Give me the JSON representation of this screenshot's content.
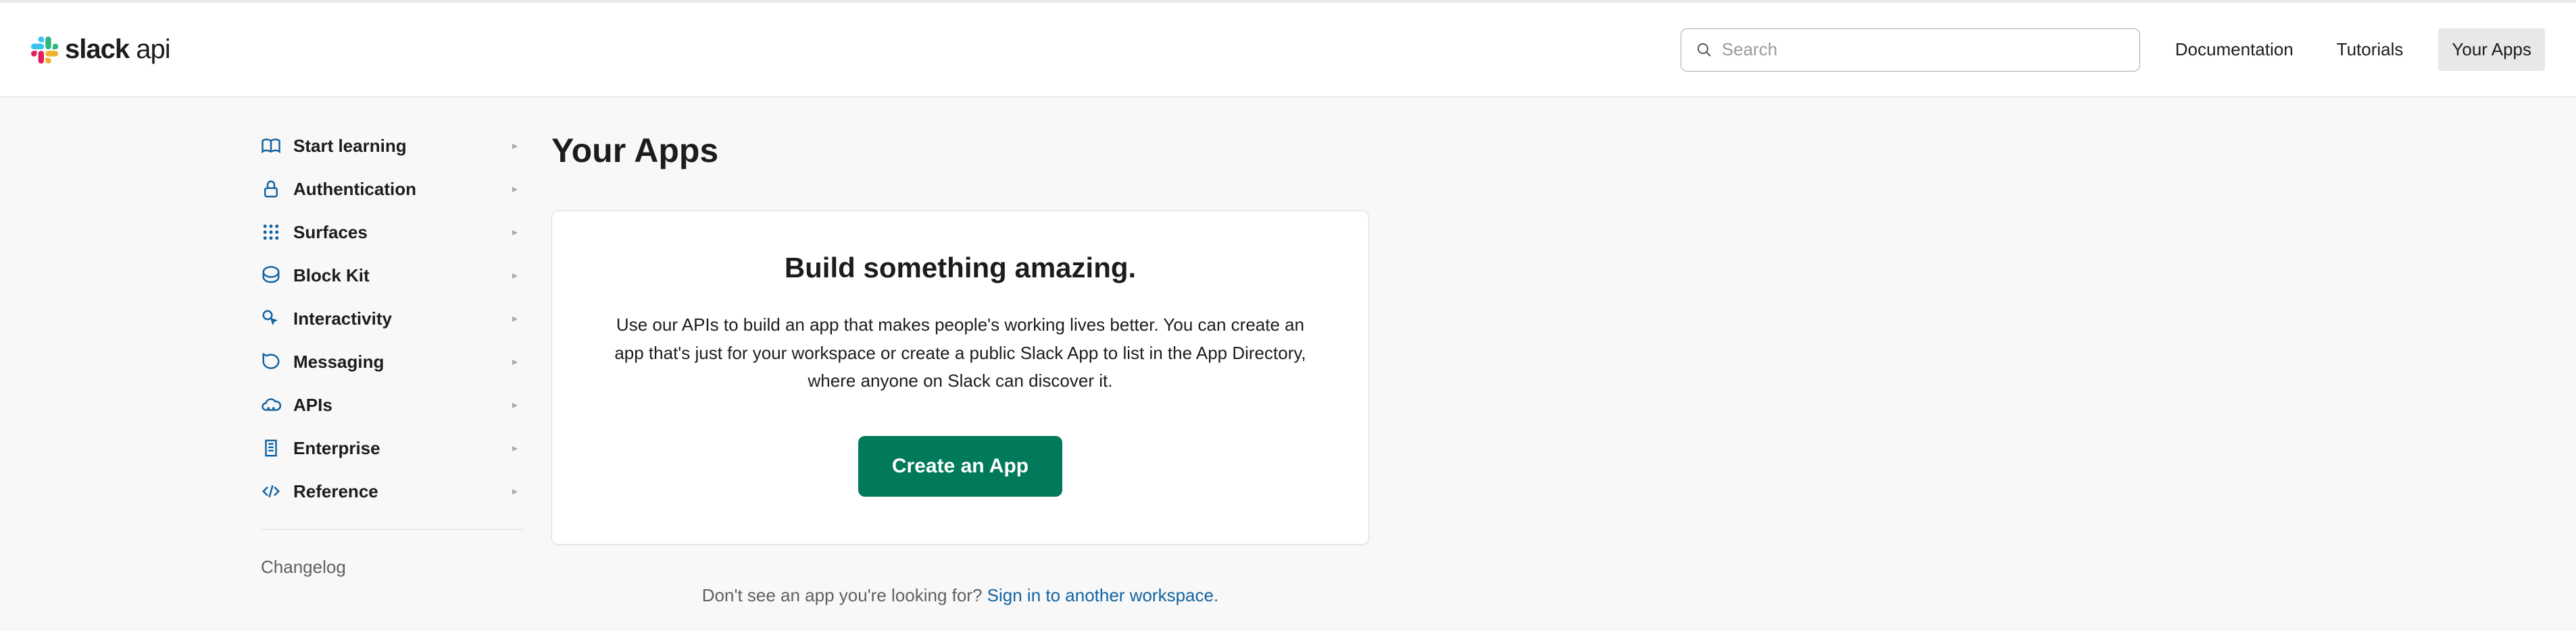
{
  "header": {
    "brand_bold": "slack",
    "brand_light": " api",
    "search_placeholder": "Search",
    "nav": {
      "documentation": "Documentation",
      "tutorials": "Tutorials",
      "your_apps": "Your Apps"
    }
  },
  "sidebar": {
    "items": [
      {
        "label": "Start learning"
      },
      {
        "label": "Authentication"
      },
      {
        "label": "Surfaces"
      },
      {
        "label": "Block Kit"
      },
      {
        "label": "Interactivity"
      },
      {
        "label": "Messaging"
      },
      {
        "label": "APIs"
      },
      {
        "label": "Enterprise"
      },
      {
        "label": "Reference"
      }
    ],
    "secondary": {
      "changelog": "Changelog"
    }
  },
  "main": {
    "title": "Your Apps",
    "card": {
      "title": "Build something amazing.",
      "description": "Use our APIs to build an app that makes people's working lives better. You can create an app that's just for your workspace or create a public Slack App to list in the App Directory, where anyone on Slack can discover it.",
      "button": "Create an App"
    },
    "footer": {
      "prefix": "Don't see an app you're looking for? ",
      "link": "Sign in to another workspace",
      "suffix": "."
    }
  }
}
